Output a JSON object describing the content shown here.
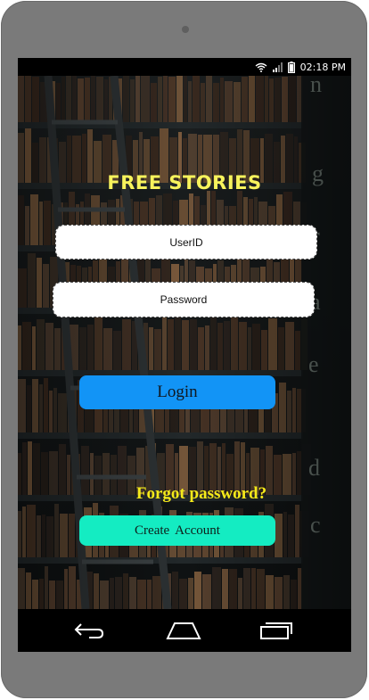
{
  "status_bar": {
    "time": "02:18 PM",
    "icons": [
      "wifi-icon",
      "signal-icon",
      "battery-icon"
    ]
  },
  "app": {
    "title": "FREE STORIES",
    "userid_placeholder": "UserID",
    "password_placeholder": "Password",
    "login_label": "Login",
    "forgot_label": "Forgot password?",
    "create_label": "Create  Account"
  },
  "nav_bar": {
    "icons": [
      "back-icon",
      "home-icon",
      "recents-icon"
    ]
  },
  "colors": {
    "title": "#f7f35c",
    "login_button": "#1294f6",
    "create_button": "#14ecc2",
    "forgot_text": "#f5ea1a",
    "device_frame": "#7a7a7a"
  }
}
